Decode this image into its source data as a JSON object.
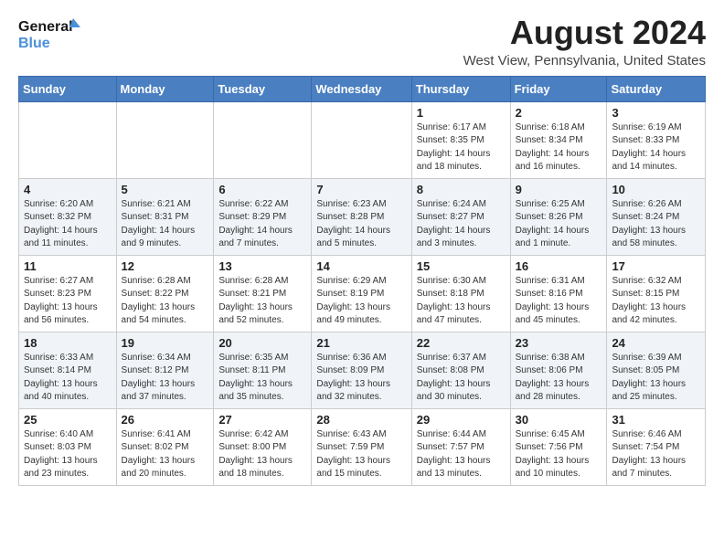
{
  "logo": {
    "name": "General",
    "name2": "Blue"
  },
  "title": "August 2024",
  "location": "West View, Pennsylvania, United States",
  "weekdays": [
    "Sunday",
    "Monday",
    "Tuesday",
    "Wednesday",
    "Thursday",
    "Friday",
    "Saturday"
  ],
  "weeks": [
    [
      {
        "day": "",
        "info": ""
      },
      {
        "day": "",
        "info": ""
      },
      {
        "day": "",
        "info": ""
      },
      {
        "day": "",
        "info": ""
      },
      {
        "day": "1",
        "info": "Sunrise: 6:17 AM\nSunset: 8:35 PM\nDaylight: 14 hours\nand 18 minutes."
      },
      {
        "day": "2",
        "info": "Sunrise: 6:18 AM\nSunset: 8:34 PM\nDaylight: 14 hours\nand 16 minutes."
      },
      {
        "day": "3",
        "info": "Sunrise: 6:19 AM\nSunset: 8:33 PM\nDaylight: 14 hours\nand 14 minutes."
      }
    ],
    [
      {
        "day": "4",
        "info": "Sunrise: 6:20 AM\nSunset: 8:32 PM\nDaylight: 14 hours\nand 11 minutes."
      },
      {
        "day": "5",
        "info": "Sunrise: 6:21 AM\nSunset: 8:31 PM\nDaylight: 14 hours\nand 9 minutes."
      },
      {
        "day": "6",
        "info": "Sunrise: 6:22 AM\nSunset: 8:29 PM\nDaylight: 14 hours\nand 7 minutes."
      },
      {
        "day": "7",
        "info": "Sunrise: 6:23 AM\nSunset: 8:28 PM\nDaylight: 14 hours\nand 5 minutes."
      },
      {
        "day": "8",
        "info": "Sunrise: 6:24 AM\nSunset: 8:27 PM\nDaylight: 14 hours\nand 3 minutes."
      },
      {
        "day": "9",
        "info": "Sunrise: 6:25 AM\nSunset: 8:26 PM\nDaylight: 14 hours\nand 1 minute."
      },
      {
        "day": "10",
        "info": "Sunrise: 6:26 AM\nSunset: 8:24 PM\nDaylight: 13 hours\nand 58 minutes."
      }
    ],
    [
      {
        "day": "11",
        "info": "Sunrise: 6:27 AM\nSunset: 8:23 PM\nDaylight: 13 hours\nand 56 minutes."
      },
      {
        "day": "12",
        "info": "Sunrise: 6:28 AM\nSunset: 8:22 PM\nDaylight: 13 hours\nand 54 minutes."
      },
      {
        "day": "13",
        "info": "Sunrise: 6:28 AM\nSunset: 8:21 PM\nDaylight: 13 hours\nand 52 minutes."
      },
      {
        "day": "14",
        "info": "Sunrise: 6:29 AM\nSunset: 8:19 PM\nDaylight: 13 hours\nand 49 minutes."
      },
      {
        "day": "15",
        "info": "Sunrise: 6:30 AM\nSunset: 8:18 PM\nDaylight: 13 hours\nand 47 minutes."
      },
      {
        "day": "16",
        "info": "Sunrise: 6:31 AM\nSunset: 8:16 PM\nDaylight: 13 hours\nand 45 minutes."
      },
      {
        "day": "17",
        "info": "Sunrise: 6:32 AM\nSunset: 8:15 PM\nDaylight: 13 hours\nand 42 minutes."
      }
    ],
    [
      {
        "day": "18",
        "info": "Sunrise: 6:33 AM\nSunset: 8:14 PM\nDaylight: 13 hours\nand 40 minutes."
      },
      {
        "day": "19",
        "info": "Sunrise: 6:34 AM\nSunset: 8:12 PM\nDaylight: 13 hours\nand 37 minutes."
      },
      {
        "day": "20",
        "info": "Sunrise: 6:35 AM\nSunset: 8:11 PM\nDaylight: 13 hours\nand 35 minutes."
      },
      {
        "day": "21",
        "info": "Sunrise: 6:36 AM\nSunset: 8:09 PM\nDaylight: 13 hours\nand 32 minutes."
      },
      {
        "day": "22",
        "info": "Sunrise: 6:37 AM\nSunset: 8:08 PM\nDaylight: 13 hours\nand 30 minutes."
      },
      {
        "day": "23",
        "info": "Sunrise: 6:38 AM\nSunset: 8:06 PM\nDaylight: 13 hours\nand 28 minutes."
      },
      {
        "day": "24",
        "info": "Sunrise: 6:39 AM\nSunset: 8:05 PM\nDaylight: 13 hours\nand 25 minutes."
      }
    ],
    [
      {
        "day": "25",
        "info": "Sunrise: 6:40 AM\nSunset: 8:03 PM\nDaylight: 13 hours\nand 23 minutes."
      },
      {
        "day": "26",
        "info": "Sunrise: 6:41 AM\nSunset: 8:02 PM\nDaylight: 13 hours\nand 20 minutes."
      },
      {
        "day": "27",
        "info": "Sunrise: 6:42 AM\nSunset: 8:00 PM\nDaylight: 13 hours\nand 18 minutes."
      },
      {
        "day": "28",
        "info": "Sunrise: 6:43 AM\nSunset: 7:59 PM\nDaylight: 13 hours\nand 15 minutes."
      },
      {
        "day": "29",
        "info": "Sunrise: 6:44 AM\nSunset: 7:57 PM\nDaylight: 13 hours\nand 13 minutes."
      },
      {
        "day": "30",
        "info": "Sunrise: 6:45 AM\nSunset: 7:56 PM\nDaylight: 13 hours\nand 10 minutes."
      },
      {
        "day": "31",
        "info": "Sunrise: 6:46 AM\nSunset: 7:54 PM\nDaylight: 13 hours\nand 7 minutes."
      }
    ]
  ]
}
